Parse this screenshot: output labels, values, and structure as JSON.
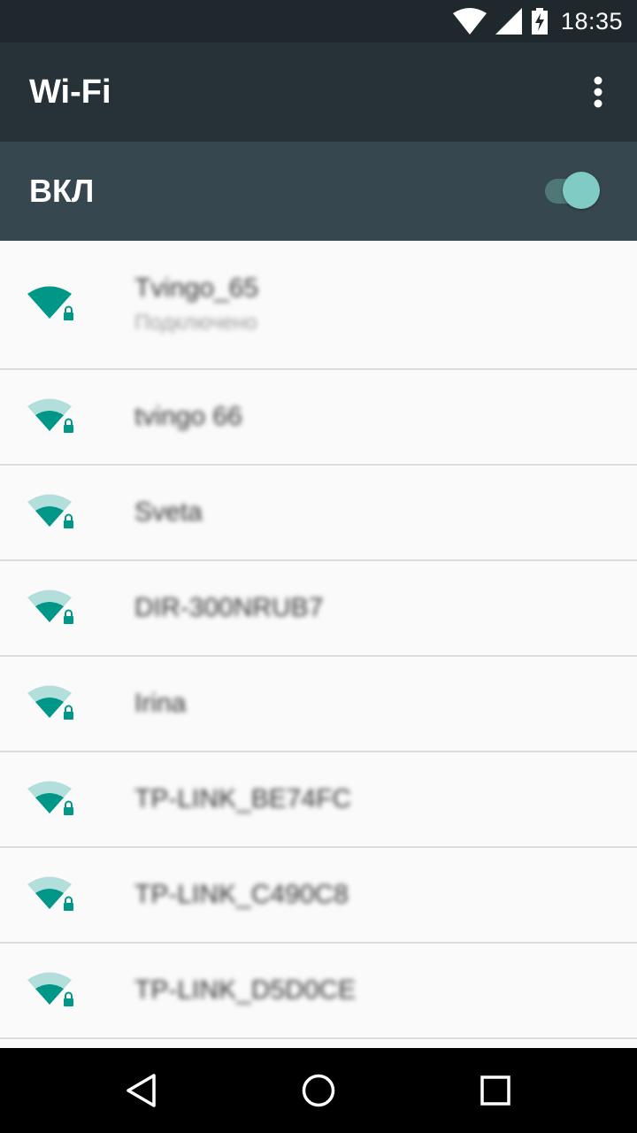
{
  "status_bar": {
    "time": "18:35",
    "icons": [
      "wifi-signal-icon",
      "cell-signal-icon",
      "battery-charging-icon"
    ]
  },
  "app_bar": {
    "title": "Wi-Fi",
    "menu_icon": "overflow-menu-icon"
  },
  "wifi_switch": {
    "label": "ВКЛ",
    "state": "on"
  },
  "networks": [
    {
      "name": "Tvingo_65",
      "status": "Подключено",
      "signal": "full",
      "secured": true
    },
    {
      "name": "tvingo 66",
      "signal": "medium",
      "secured": true
    },
    {
      "name": "Sveta",
      "signal": "medium",
      "secured": true
    },
    {
      "name": "DIR-300NRUB7",
      "signal": "medium",
      "secured": true
    },
    {
      "name": "Irina",
      "signal": "medium",
      "secured": true
    },
    {
      "name": "TP-LINK_BE74FC",
      "signal": "medium",
      "secured": true
    },
    {
      "name": "TP-LINK_C490C8",
      "signal": "medium",
      "secured": true
    },
    {
      "name": "TP-LINK_D5D0CE",
      "signal": "medium",
      "secured": true
    }
  ],
  "nav_bar": {
    "buttons": [
      "back-icon",
      "home-icon",
      "recents-icon"
    ]
  },
  "colors": {
    "status_bar": "#1f282d",
    "app_bar": "#263238",
    "switch_bar": "#37474f",
    "accent": "#009688",
    "accent_light": "#80cbc4"
  }
}
